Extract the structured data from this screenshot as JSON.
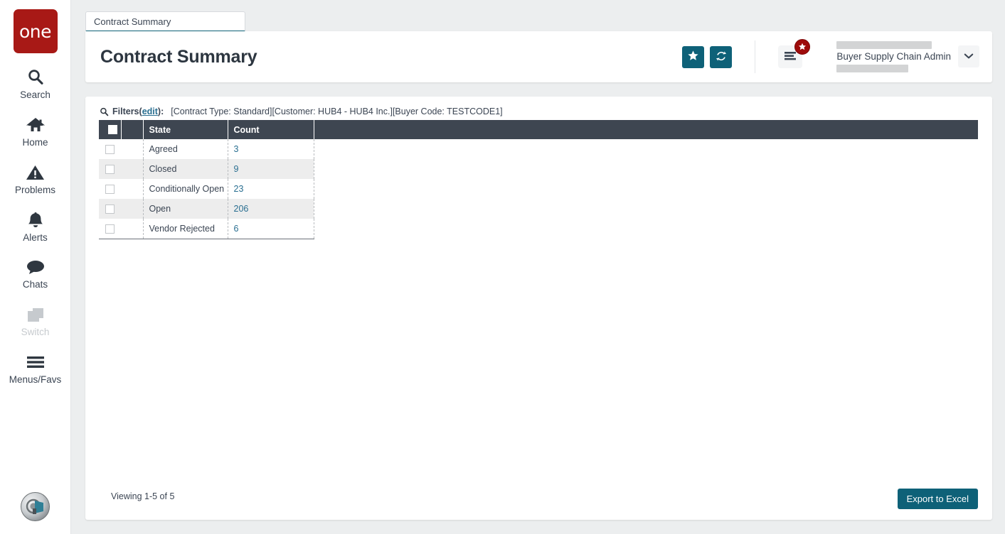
{
  "sidebar": {
    "logo_text": "one",
    "items": [
      {
        "label": "Search",
        "icon": "search-icon",
        "disabled": false
      },
      {
        "label": "Home",
        "icon": "home-icon",
        "disabled": false
      },
      {
        "label": "Problems",
        "icon": "warning-triangle-icon",
        "disabled": false
      },
      {
        "label": "Alerts",
        "icon": "bell-icon",
        "disabled": false
      },
      {
        "label": "Chats",
        "icon": "chat-bubble-icon",
        "disabled": false
      },
      {
        "label": "Switch",
        "icon": "switch-windows-icon",
        "disabled": true
      },
      {
        "label": "Menus/Favs",
        "icon": "hamburger-icon",
        "disabled": false
      }
    ],
    "avatar_name": "user-avatar"
  },
  "tabs": [
    {
      "label": "Contract Summary",
      "active": true
    }
  ],
  "header": {
    "title": "Contract Summary",
    "favorite_icon": "star-icon",
    "refresh_icon": "refresh-icon",
    "menu_icon": "hamburger-menu-icon",
    "menu_badge_icon": "star-badge-icon",
    "user_role": "Buyer Supply Chain Admin",
    "user_caret_icon": "chevron-down-icon"
  },
  "filters": {
    "search_icon": "search-icon",
    "label": "Filters",
    "open_paren": "(",
    "edit_label": "edit",
    "close_paren": "):",
    "values": "[Contract Type: Standard][Customer: HUB4 - HUB4 Inc.][Buyer Code: TESTCODE1]"
  },
  "table": {
    "columns": [
      "",
      "",
      "State",
      "Count",
      ""
    ],
    "rows": [
      {
        "state": "Agreed",
        "count": "3"
      },
      {
        "state": "Closed",
        "count": "9"
      },
      {
        "state": "Conditionally Open",
        "count": "23"
      },
      {
        "state": "Open",
        "count": "206"
      },
      {
        "state": "Vendor Rejected",
        "count": "6"
      }
    ]
  },
  "footer": {
    "viewing": "Viewing 1-5 of 5",
    "export_label": "Export to Excel"
  },
  "colors": {
    "teal": "#0e6178",
    "brand_red": "#a81916",
    "badge_red": "#9e0b0b",
    "header_dark": "#3e4651",
    "link_blue": "#2a6f91",
    "page_bg": "#eceeef",
    "row_alt": "#ededed"
  }
}
